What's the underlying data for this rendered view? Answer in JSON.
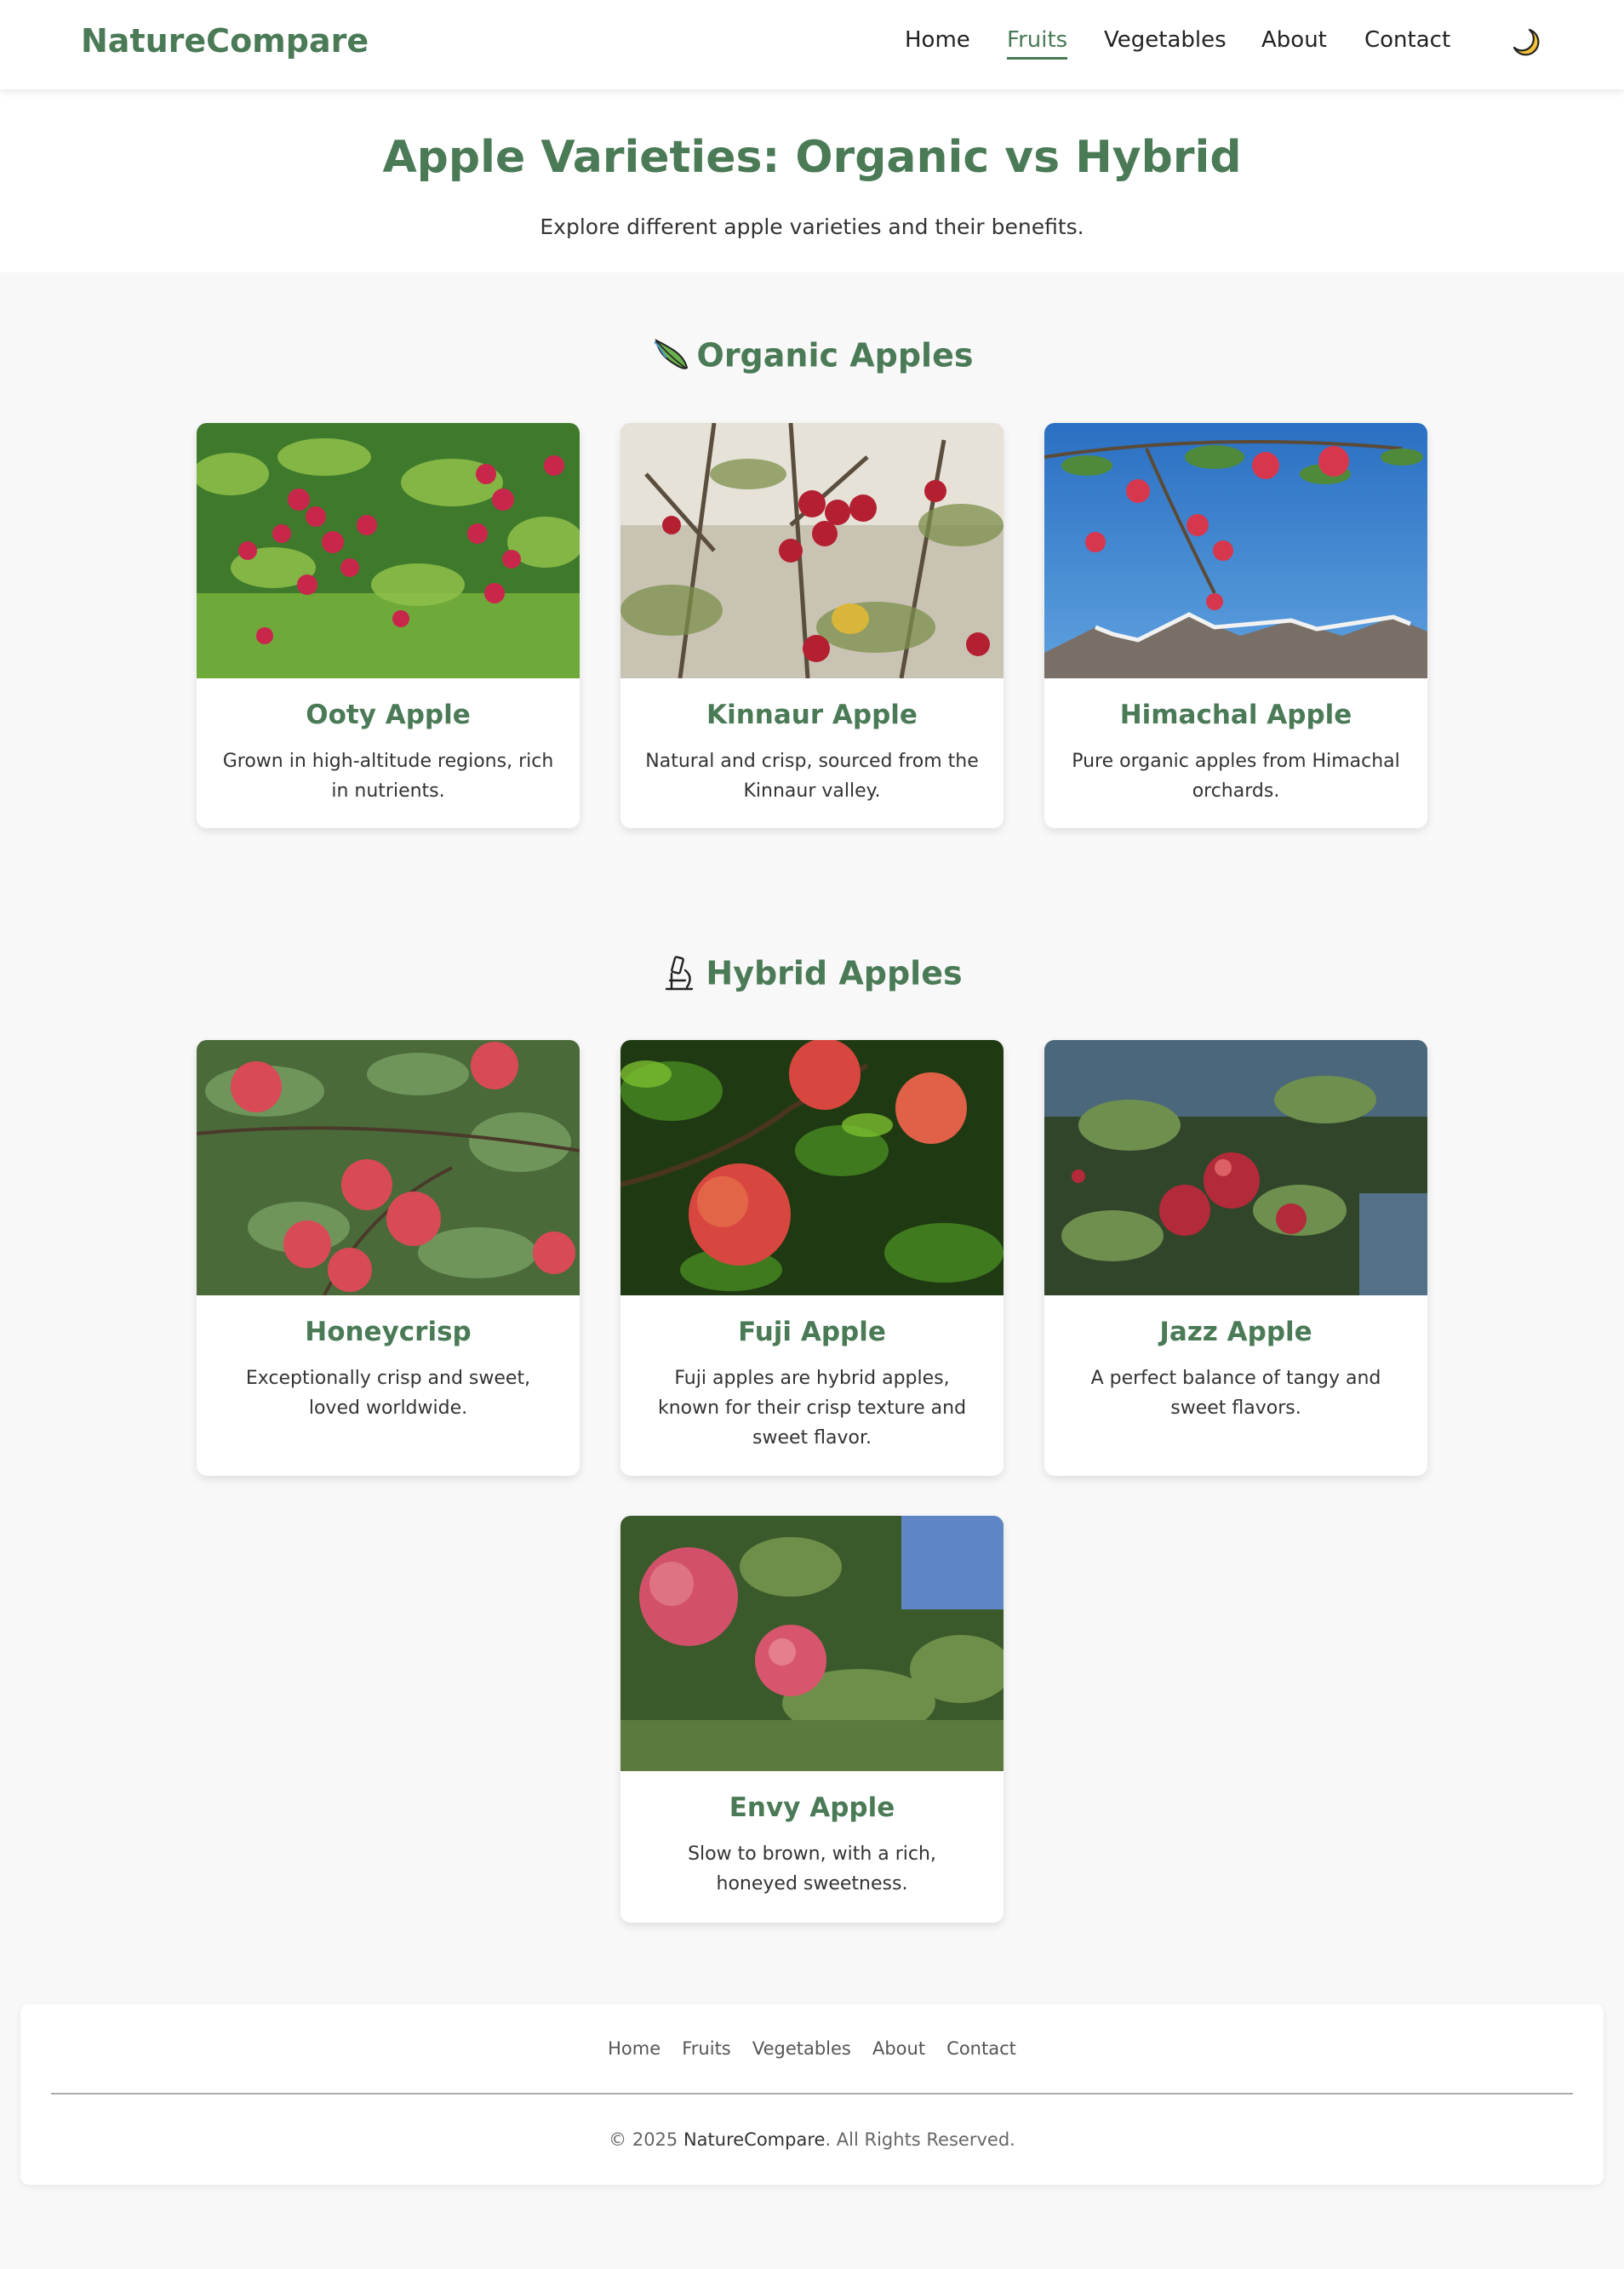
{
  "nav": {
    "brand": "NatureCompare",
    "links": [
      {
        "label": "Home",
        "active": false
      },
      {
        "label": "Fruits",
        "active": true
      },
      {
        "label": "Vegetables",
        "active": false
      },
      {
        "label": "About",
        "active": false
      },
      {
        "label": "Contact",
        "active": false
      }
    ],
    "theme_icon": "moon-icon"
  },
  "hero": {
    "title": "Apple Varieties: Organic vs Hybrid",
    "subtitle": "Explore different apple varieties and their benefits."
  },
  "organic": {
    "title": "Organic Apples",
    "icon": "leaf-icon",
    "cards": [
      {
        "name": "Ooty Apple",
        "desc": "Grown in high-altitude regions, rich in nutrients."
      },
      {
        "name": "Kinnaur Apple",
        "desc": "Natural and crisp, sourced from the Kinnaur valley."
      },
      {
        "name": "Himachal Apple",
        "desc": "Pure organic apples from Himachal orchards."
      }
    ]
  },
  "hybrid": {
    "title": "Hybrid Apples",
    "icon": "microscope-icon",
    "cards": [
      {
        "name": "Honeycrisp",
        "desc": "Exceptionally crisp and sweet, loved worldwide."
      },
      {
        "name": "Fuji Apple",
        "desc": "Fuji apples are hybrid apples, known for their crisp texture and sweet flavor."
      },
      {
        "name": "Jazz Apple",
        "desc": "A perfect balance of tangy and sweet flavors."
      },
      {
        "name": "Envy Apple",
        "desc": "Slow to brown, with a rich, honeyed sweetness."
      }
    ]
  },
  "footer": {
    "links": [
      "Home",
      "Fruits",
      "Vegetables",
      "About",
      "Contact"
    ],
    "copy_prefix": "© 2025 ",
    "copy_brand": "NatureCompare",
    "copy_suffix": ". All Rights Reserved."
  },
  "colors": {
    "accent": "#4a7a56",
    "background": "#f8f8f8"
  }
}
